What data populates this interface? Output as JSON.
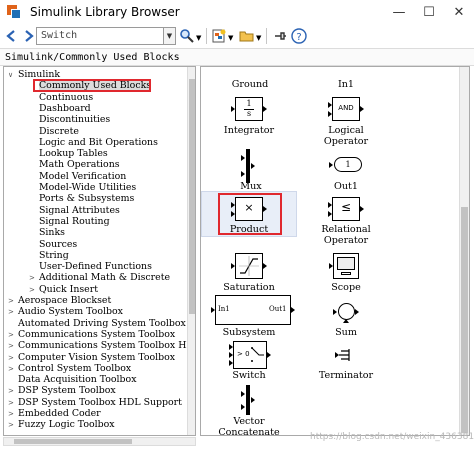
{
  "window": {
    "title": "Simulink Library Browser",
    "minimize": "—",
    "maximize": "☐",
    "close": "✕"
  },
  "toolbar": {
    "search_value": "Switch",
    "icons": [
      "back-icon",
      "forward-icon",
      "search-options-icon",
      "new-model-icon",
      "open-icon",
      "pin-icon",
      "help-icon"
    ]
  },
  "breadcrumb": "Simulink/Commonly Used Blocks",
  "tree": {
    "items": [
      {
        "label": "Simulink",
        "arrow": "∨",
        "level": 0
      },
      {
        "label": "Commonly Used Blocks",
        "arrow": "",
        "level": 1,
        "selected": true
      },
      {
        "label": "Continuous",
        "arrow": "",
        "level": 1
      },
      {
        "label": "Dashboard",
        "arrow": "",
        "level": 1
      },
      {
        "label": "Discontinuities",
        "arrow": "",
        "level": 1
      },
      {
        "label": "Discrete",
        "arrow": "",
        "level": 1
      },
      {
        "label": "Logic and Bit Operations",
        "arrow": "",
        "level": 1
      },
      {
        "label": "Lookup Tables",
        "arrow": "",
        "level": 1
      },
      {
        "label": "Math Operations",
        "arrow": "",
        "level": 1
      },
      {
        "label": "Model Verification",
        "arrow": "",
        "level": 1
      },
      {
        "label": "Model-Wide Utilities",
        "arrow": "",
        "level": 1
      },
      {
        "label": "Ports & Subsystems",
        "arrow": "",
        "level": 1
      },
      {
        "label": "Signal Attributes",
        "arrow": "",
        "level": 1
      },
      {
        "label": "Signal Routing",
        "arrow": "",
        "level": 1
      },
      {
        "label": "Sinks",
        "arrow": "",
        "level": 1
      },
      {
        "label": "Sources",
        "arrow": "",
        "level": 1
      },
      {
        "label": "String",
        "arrow": "",
        "level": 1
      },
      {
        "label": "User-Defined Functions",
        "arrow": "",
        "level": 1
      },
      {
        "label": "Additional Math & Discrete",
        "arrow": ">",
        "level": 1
      },
      {
        "label": "Quick Insert",
        "arrow": ">",
        "level": 1
      },
      {
        "label": "Aerospace Blockset",
        "arrow": ">",
        "level": 0
      },
      {
        "label": "Audio System Toolbox",
        "arrow": ">",
        "level": 0
      },
      {
        "label": "Automated Driving System Toolbox",
        "arrow": "",
        "level": 0
      },
      {
        "label": "Communications System Toolbox",
        "arrow": ">",
        "level": 0
      },
      {
        "label": "Communications System Toolbox HDL",
        "arrow": ">",
        "level": 0
      },
      {
        "label": "Computer Vision System Toolbox",
        "arrow": ">",
        "level": 0
      },
      {
        "label": "Control System Toolbox",
        "arrow": ">",
        "level": 0
      },
      {
        "label": "Data Acquisition Toolbox",
        "arrow": "",
        "level": 0
      },
      {
        "label": "DSP System Toolbox",
        "arrow": ">",
        "level": 0
      },
      {
        "label": "DSP System Toolbox HDL Support",
        "arrow": ">",
        "level": 0
      },
      {
        "label": "Embedded Coder",
        "arrow": ">",
        "level": 0
      },
      {
        "label": "Fuzzy Logic Toolbox",
        "arrow": ">",
        "level": 0
      }
    ]
  },
  "blocks": {
    "ground": "Ground",
    "in1": "In1",
    "integrator": "Integrator",
    "integrator_num": "1",
    "integrator_den": "s",
    "logical_operator": "Logical\nOperator",
    "logical_operator_text": "AND",
    "mux": "Mux",
    "out1": "Out1",
    "out1_num": "1",
    "product": "Product",
    "product_sym": "×",
    "relational_operator": "Relational\nOperator",
    "relational_sym": "≤",
    "saturation": "Saturation",
    "scope": "Scope",
    "subsystem": "Subsystem",
    "subsystem_in": "In1",
    "subsystem_out": "Out1",
    "sum": "Sum",
    "switch": "Switch",
    "switch_thresh": "> 0",
    "terminator": "Terminator",
    "vector_concatenate": "Vector\nConcatenate"
  },
  "watermark": "https://blog.csdn.net/weixin_43638176"
}
